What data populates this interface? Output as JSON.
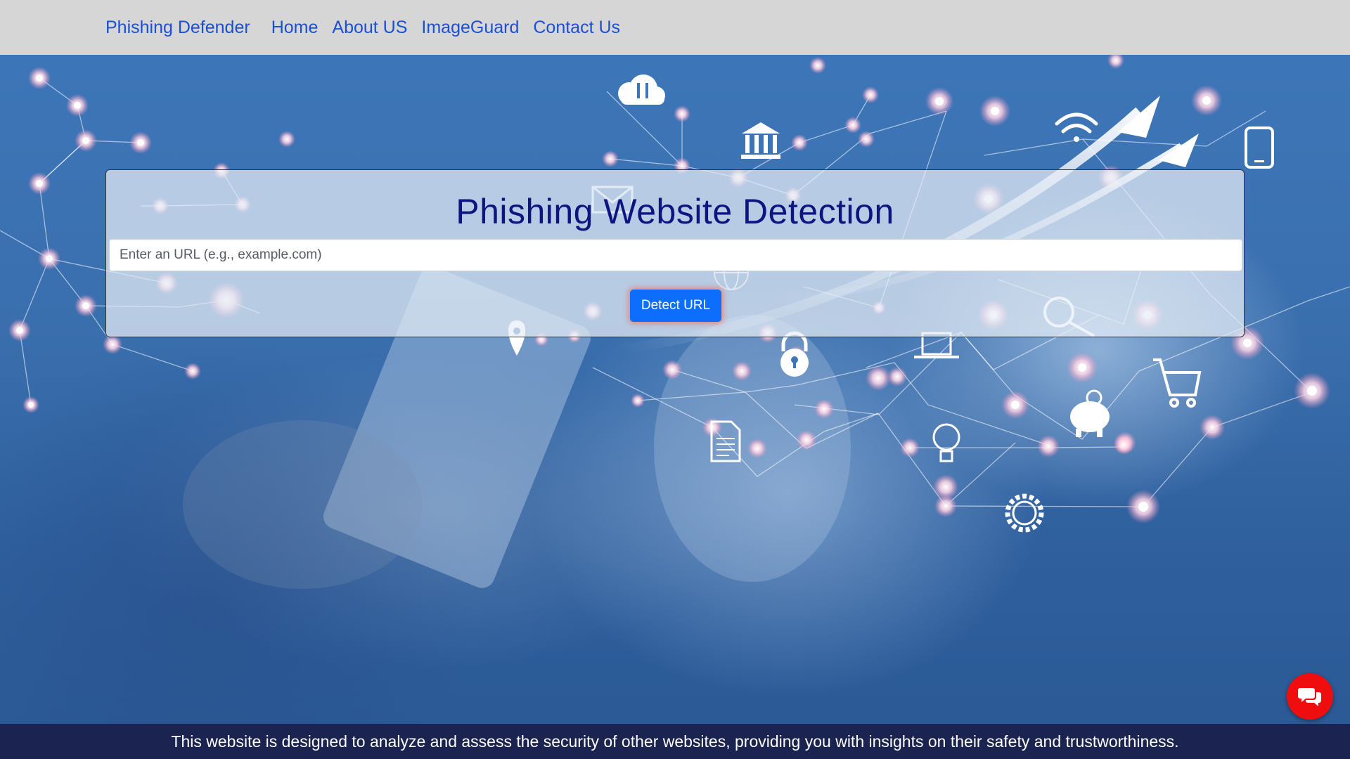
{
  "navbar": {
    "brand": "Phishing Defender",
    "links": [
      "Home",
      "About US",
      "ImageGuard",
      "Contact Us"
    ]
  },
  "detector": {
    "title": "Phishing Website Detection",
    "url_placeholder": "Enter an URL (e.g., example.com)",
    "detect_button": "Detect URL"
  },
  "footer": {
    "text": "This website is designed to analyze and assess the security of other websites, providing you with insights on their safety and trustworthiness."
  },
  "background_icons": [
    "cloud-sync-icon",
    "bank-icon",
    "wifi-icon",
    "mobile-phone-icon",
    "mail-icon",
    "globe-icon",
    "location-pin-icon",
    "padlock-icon",
    "laptop-icon",
    "magnifier-chart-icon",
    "shopping-cart-icon",
    "piggy-bank-icon",
    "document-icon",
    "lightbulb-icon",
    "gear-icon",
    "growth-arrow-icon"
  ],
  "colors": {
    "navbar_bg": "#d6d6d6",
    "nav_link": "#1a4fd6",
    "title": "#0d1680",
    "button": "#0d6efd",
    "footer_bg": "#1b2350",
    "chat_button": "#f00d0d"
  }
}
